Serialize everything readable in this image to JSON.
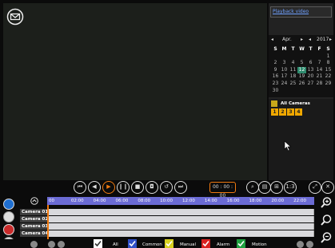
{
  "video": {
    "icon": "mail-icon"
  },
  "side": {
    "title": "Playback video",
    "calendar": {
      "month": "Apr.",
      "year": "2017",
      "weekdays": [
        "S",
        "M",
        "T",
        "W",
        "T",
        "F",
        "S"
      ],
      "weeks": [
        [
          "",
          "",
          "",
          "",
          "",
          "",
          "1"
        ],
        [
          "2",
          "3",
          "4",
          "5",
          "6",
          "7",
          "8"
        ],
        [
          "9",
          "10",
          "11",
          "12",
          "13",
          "14",
          "15"
        ],
        [
          "16",
          "17",
          "18",
          "19",
          "20",
          "21",
          "22"
        ],
        [
          "23",
          "24",
          "25",
          "26",
          "27",
          "28",
          "29"
        ],
        [
          "30",
          "",
          "",
          "",
          "",
          "",
          ""
        ]
      ],
      "selected_day": "12",
      "selected_color": "#2e8b6e"
    },
    "all_cameras_label": "All Cameras",
    "camera_numbers": [
      "1",
      "2",
      "3",
      "4"
    ]
  },
  "controls": {
    "time": "00 : 00 : 00",
    "accent_color": "#f07a10",
    "buttons": [
      "skip-back-icon",
      "prev-icon",
      "play-icon",
      "pause-icon",
      "stop-icon",
      "snapshot-icon",
      "rewind-icon",
      "skip-forward-icon",
      "search-icon",
      "save-icon",
      "grid-view-icon",
      "speed-icon",
      "fullscreen-icon",
      "close-icon"
    ]
  },
  "timeline": {
    "ticks": [
      "00",
      "02:00",
      "04:00",
      "06:00",
      "08:00",
      "10:00",
      "12:00",
      "14:00",
      "16:00",
      "18:00",
      "20:00",
      "22:00"
    ],
    "cameras": [
      "Camera 01",
      "Camera 02",
      "Camera 03",
      "Camera 04"
    ],
    "axis_color": "#6b6bd4"
  },
  "legend": {
    "items": [
      {
        "label": "All",
        "color": "#ffffff"
      },
      {
        "label": "Common",
        "color": "#3050c8"
      },
      {
        "label": "Manual",
        "color": "#d8d020"
      },
      {
        "label": "Alarm",
        "color": "#d82020"
      },
      {
        "label": "Motion",
        "color": "#20a040"
      }
    ]
  }
}
